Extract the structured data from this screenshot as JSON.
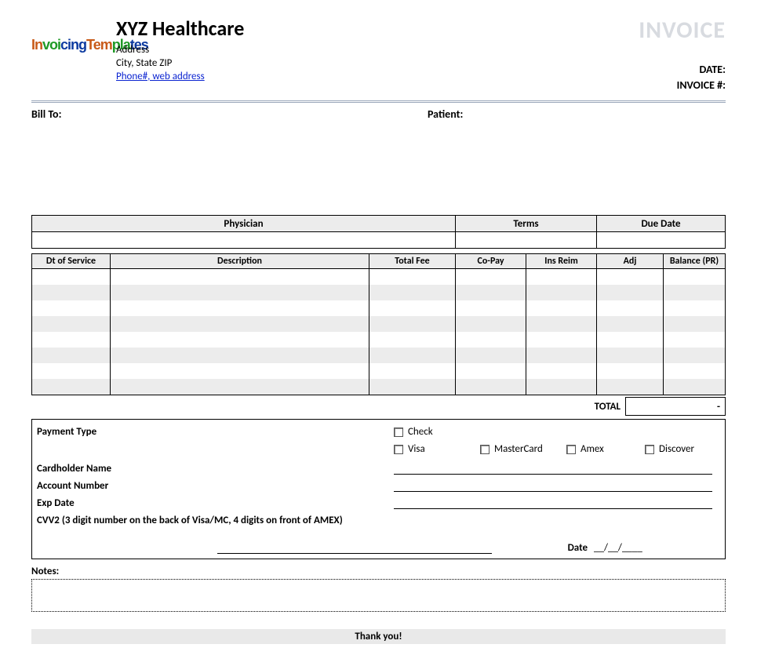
{
  "header": {
    "logo_text_parts": [
      "In",
      "voi",
      "cing",
      "Tem",
      "pla",
      "tes"
    ],
    "company_name": "XYZ Healthcare",
    "address_line1": "Address",
    "address_line2": "City, State ZIP",
    "contact_link": "Phone#, web address",
    "invoice_title": "INVOICE",
    "meta_date_label": "DATE:",
    "meta_invoice_label": "INVOICE #:"
  },
  "parties": {
    "bill_to_label": "Bill To:",
    "patient_label": "Patient:"
  },
  "summary": {
    "physician_header": "Physician",
    "terms_header": "Terms",
    "due_date_header": "Due Date",
    "physician_value": "",
    "terms_value": "",
    "due_date_value": ""
  },
  "items": {
    "headers": {
      "dt_of_service": "Dt of Service",
      "description": "Description",
      "total_fee": "Total Fee",
      "co_pay": "Co-Pay",
      "ins_reim": "Ins Reim",
      "adj": "Adj",
      "balance_pr": "Balance (PR)"
    },
    "rows": [
      {
        "dt": "",
        "desc": "",
        "fee": "",
        "copay": "",
        "reim": "",
        "adj": "",
        "bal": ""
      },
      {
        "dt": "",
        "desc": "",
        "fee": "",
        "copay": "",
        "reim": "",
        "adj": "",
        "bal": ""
      },
      {
        "dt": "",
        "desc": "",
        "fee": "",
        "copay": "",
        "reim": "",
        "adj": "",
        "bal": ""
      },
      {
        "dt": "",
        "desc": "",
        "fee": "",
        "copay": "",
        "reim": "",
        "adj": "",
        "bal": ""
      },
      {
        "dt": "",
        "desc": "",
        "fee": "",
        "copay": "",
        "reim": "",
        "adj": "",
        "bal": ""
      },
      {
        "dt": "",
        "desc": "",
        "fee": "",
        "copay": "",
        "reim": "",
        "adj": "",
        "bal": ""
      },
      {
        "dt": "",
        "desc": "",
        "fee": "",
        "copay": "",
        "reim": "",
        "adj": "",
        "bal": ""
      },
      {
        "dt": "",
        "desc": "",
        "fee": "",
        "copay": "",
        "reim": "",
        "adj": "",
        "bal": ""
      }
    ],
    "total_label": "TOTAL",
    "total_value": "-"
  },
  "payment": {
    "type_label": "Payment Type",
    "check": "Check",
    "visa": "Visa",
    "mastercard": "MasterCard",
    "amex": "Amex",
    "discover": "Discover",
    "cardholder_label": "Cardholder Name",
    "account_label": "Account Number",
    "exp_label": "Exp Date",
    "cvv_label": "CVV2 (3 digit number on the back of Visa/MC, 4 digits on front of AMEX)",
    "date_label": "Date",
    "date_value": "__/__/____"
  },
  "notes": {
    "label": "Notes:"
  },
  "footer": {
    "thank_you": "Thank you!"
  }
}
